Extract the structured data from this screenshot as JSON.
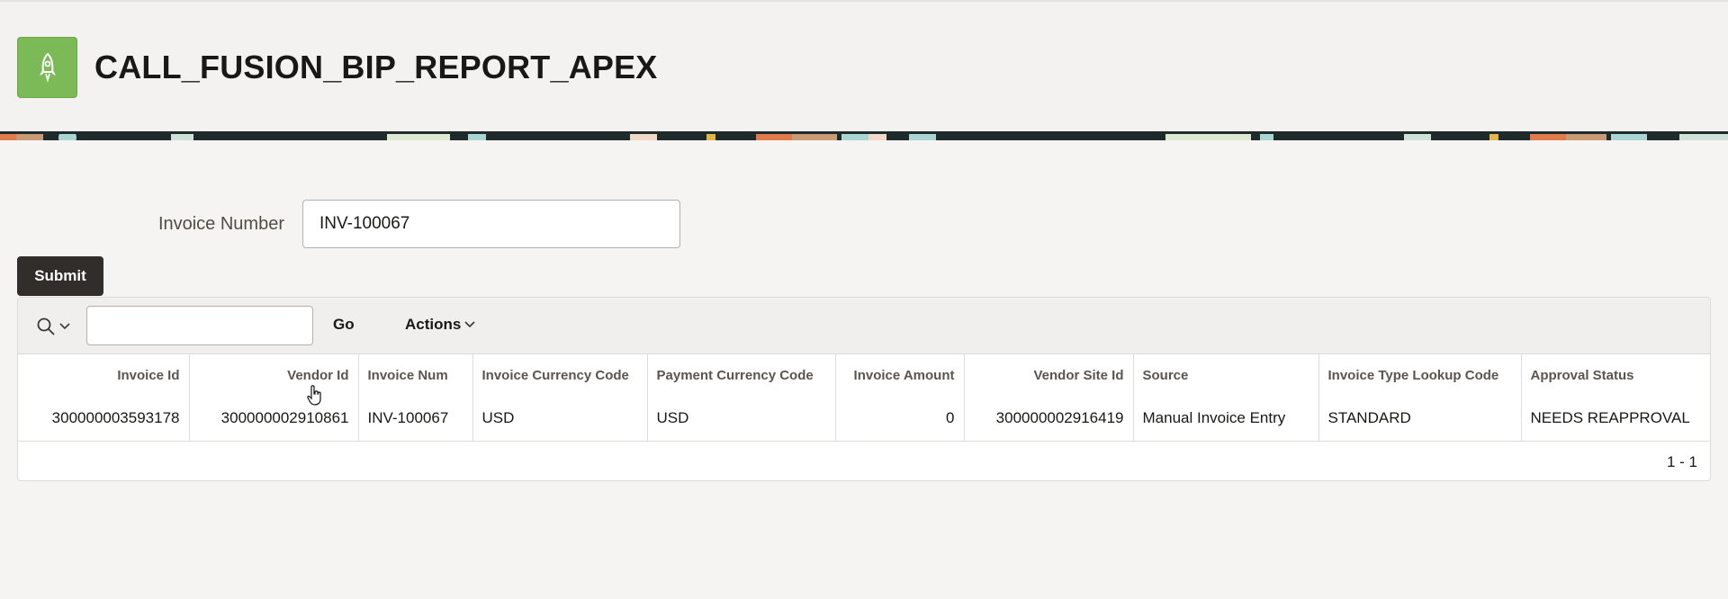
{
  "app": {
    "title": "CALL_FUSION_BIP_REPORT_APEX",
    "icon": "rocket-icon",
    "icon_color": "#7cba58"
  },
  "form": {
    "invoice_number_label": "Invoice Number",
    "invoice_number_value": "INV-100067",
    "submit_label": "Submit"
  },
  "report": {
    "toolbar": {
      "search_icon": "search-icon",
      "search_value": "",
      "go_label": "Go",
      "actions_label": "Actions"
    },
    "columns": [
      "Invoice Id",
      "Vendor Id",
      "Invoice Num",
      "Invoice Currency Code",
      "Payment Currency Code",
      "Invoice Amount",
      "Vendor Site Id",
      "Source",
      "Invoice Type Lookup Code",
      "Approval Status"
    ],
    "rows": [
      [
        "300000003593178",
        "300000002910861",
        "INV-100067",
        "USD",
        "USD",
        "0",
        "300000002916419",
        "Manual Invoice Entry",
        "STANDARD",
        "NEEDS REAPPROVAL"
      ]
    ],
    "pagination": "1 - 1"
  },
  "colors": {
    "submit_bg": "#312d2a",
    "page_bg": "#f5f4f2"
  }
}
